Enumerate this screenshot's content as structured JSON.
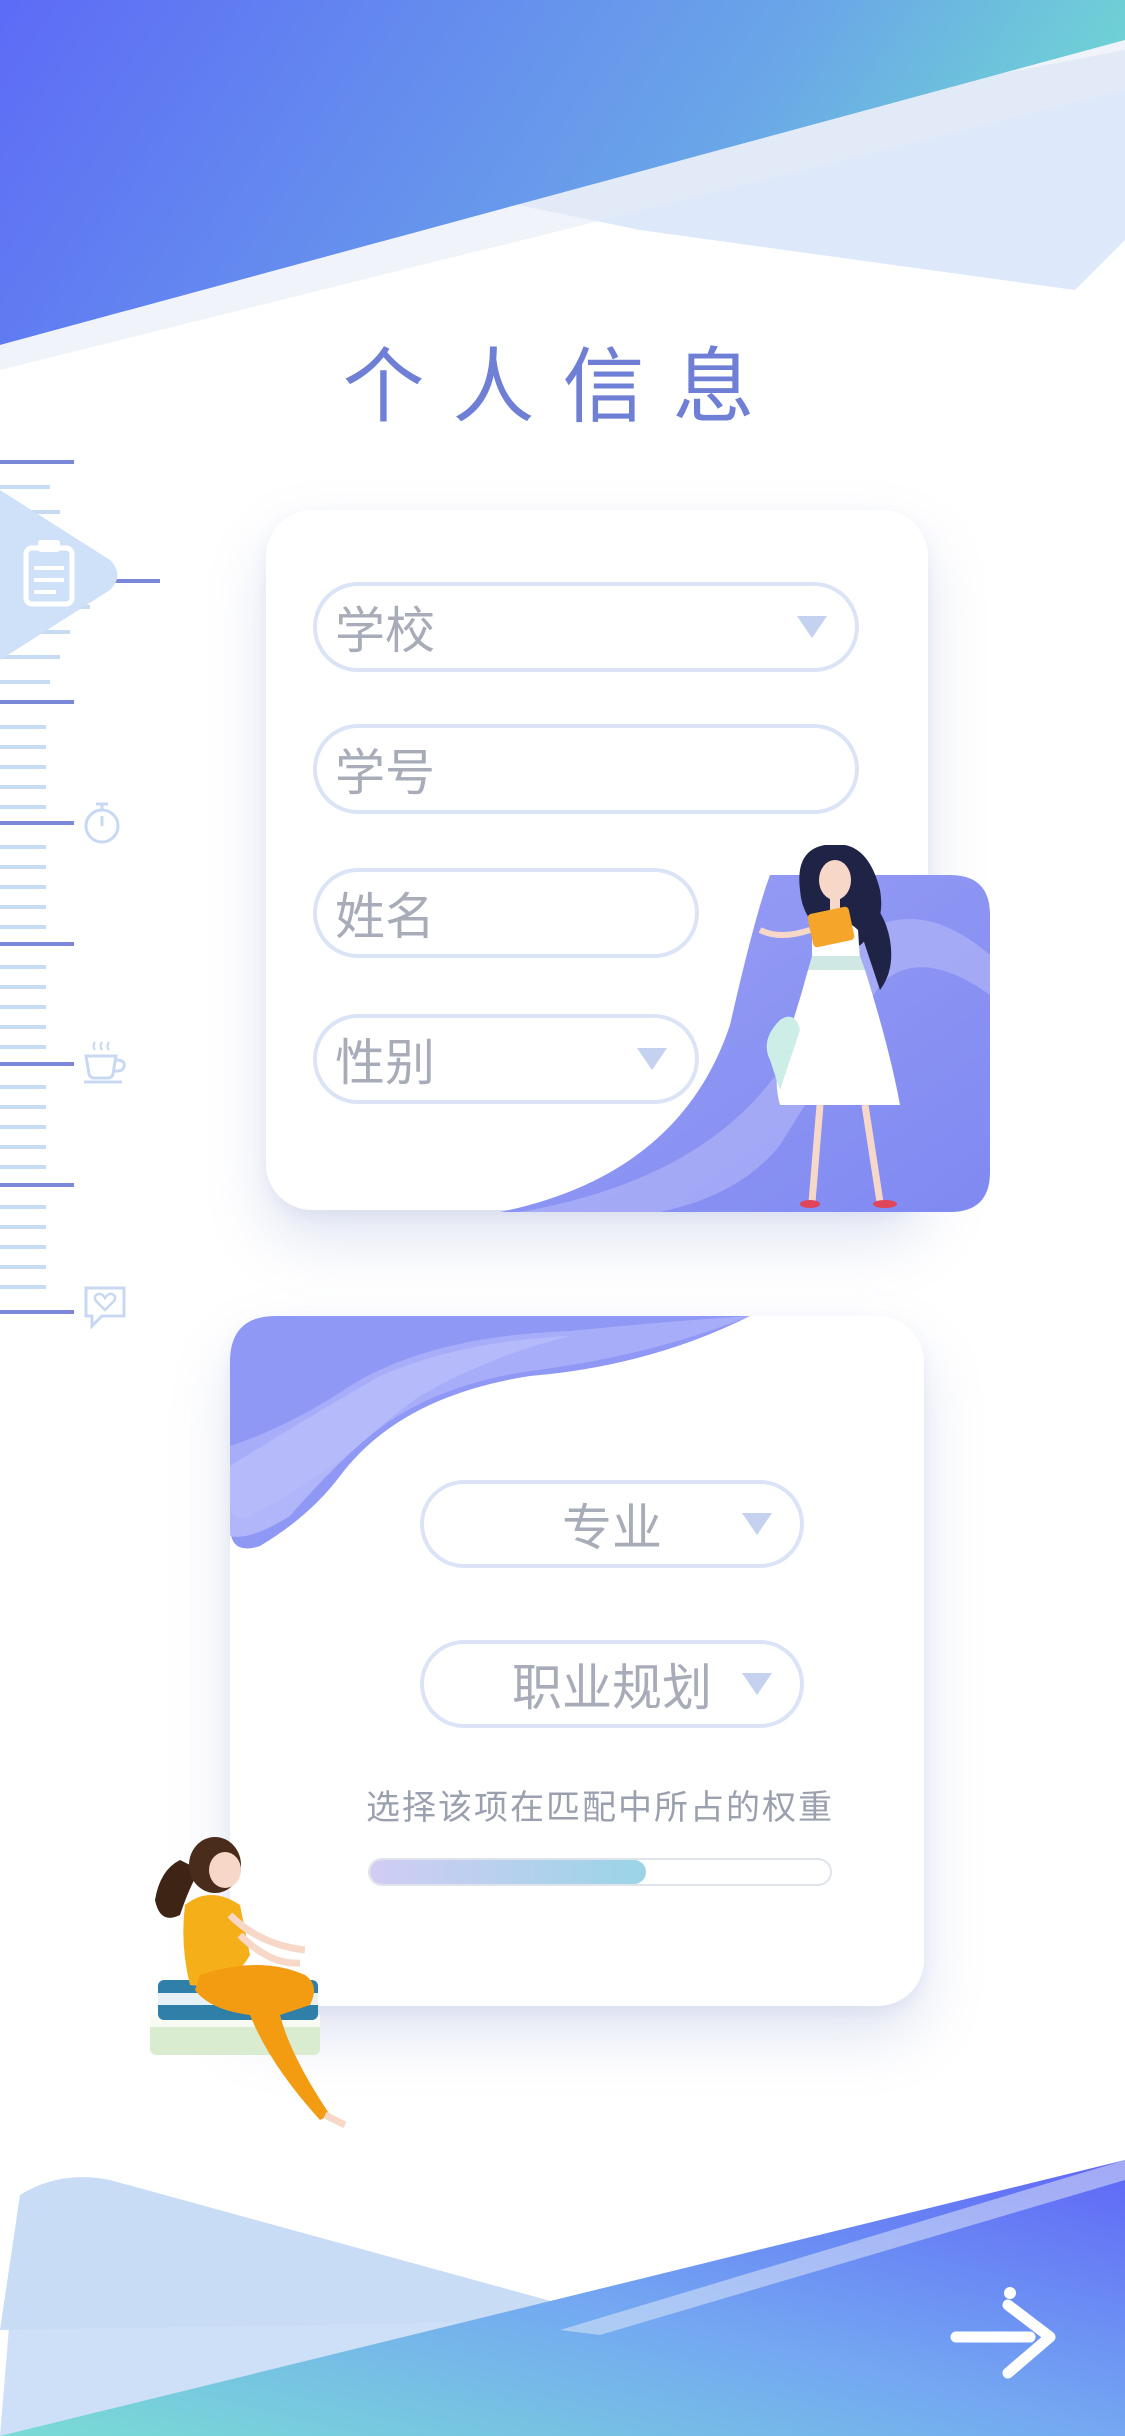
{
  "title": "个人信息",
  "form": {
    "school": {
      "placeholder": "学校",
      "icon": "chevron-down-icon"
    },
    "student_id": {
      "placeholder": "学号"
    },
    "name": {
      "placeholder": "姓名"
    },
    "gender": {
      "placeholder": "性别",
      "icon": "chevron-down-icon"
    }
  },
  "preferences": {
    "major": {
      "placeholder": "专业",
      "icon": "chevron-down-icon"
    },
    "career": {
      "placeholder": "职业规划",
      "icon": "chevron-down-icon"
    },
    "weight_label": "选择该项在匹配中所占的权重",
    "weight_fraction": 0.6
  },
  "sidebar": {
    "icons": [
      "clipboard-icon",
      "stopwatch-icon",
      "coffee-cup-icon",
      "heart-chat-icon"
    ]
  },
  "next": {
    "icon": "arrow-right-icon"
  },
  "colors": {
    "accent": "#6f7fd6",
    "gradient_start": "#5e6cf5",
    "gradient_end": "#6fd8d6",
    "pill_border": "#dbe4f6",
    "placeholder": "#a7acb8"
  }
}
